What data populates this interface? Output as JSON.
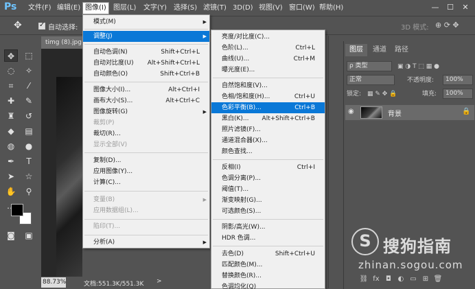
{
  "app": {
    "logo": "Ps"
  },
  "menubar": [
    {
      "label": "文件(F)"
    },
    {
      "label": "编辑(E)"
    },
    {
      "label": "图像(I)"
    },
    {
      "label": "图层(L)"
    },
    {
      "label": "文字(Y)"
    },
    {
      "label": "选择(S)"
    },
    {
      "label": "滤镜(T)"
    },
    {
      "label": "3D(D)"
    },
    {
      "label": "视图(V)"
    },
    {
      "label": "窗口(W)"
    },
    {
      "label": "帮助(H)"
    }
  ],
  "window_controls": {
    "minimize": "—",
    "maximize": "☐",
    "close": "✕"
  },
  "options": {
    "auto_select_label": "自动选择:",
    "mode_3d": "3D 模式:"
  },
  "document": {
    "tab": "timg (8).jpg",
    "zoom": "88.73%",
    "doc_size": "文档:551.3K/551.3K",
    "arrow": ">"
  },
  "image_menu": [
    {
      "label": "模式(M)",
      "submenu": true
    },
    {
      "label": "调整(J)",
      "submenu": true,
      "highlight": true
    },
    {
      "label": "自动色调(N)",
      "shortcut": "Shift+Ctrl+L"
    },
    {
      "label": "自动对比度(U)",
      "shortcut": "Alt+Shift+Ctrl+L"
    },
    {
      "label": "自动颜色(O)",
      "shortcut": "Shift+Ctrl+B"
    },
    {
      "label": "图像大小(I)...",
      "shortcut": "Alt+Ctrl+I"
    },
    {
      "label": "画布大小(S)...",
      "shortcut": "Alt+Ctrl+C"
    },
    {
      "label": "图像旋转(G)",
      "submenu": true
    },
    {
      "label": "裁剪(P)",
      "disabled": true
    },
    {
      "label": "裁切(R)..."
    },
    {
      "label": "显示全部(V)",
      "disabled": true
    },
    {
      "label": "复制(D)..."
    },
    {
      "label": "应用图像(Y)..."
    },
    {
      "label": "计算(C)..."
    },
    {
      "label": "变量(B)",
      "submenu": true,
      "disabled": true
    },
    {
      "label": "应用数据组(L)...",
      "disabled": true
    },
    {
      "label": "陷印(T)...",
      "disabled": true
    },
    {
      "label": "分析(A)",
      "submenu": true
    }
  ],
  "adjust_menu": [
    {
      "label": "亮度/对比度(C)..."
    },
    {
      "label": "色阶(L)...",
      "shortcut": "Ctrl+L"
    },
    {
      "label": "曲线(U)...",
      "shortcut": "Ctrl+M"
    },
    {
      "label": "曝光度(E)..."
    },
    {
      "label": "自然饱和度(V)..."
    },
    {
      "label": "色相/饱和度(H)...",
      "shortcut": "Ctrl+U"
    },
    {
      "label": "色彩平衡(B)...",
      "shortcut": "Ctrl+B",
      "highlight": true
    },
    {
      "label": "黑白(K)...",
      "shortcut": "Alt+Shift+Ctrl+B"
    },
    {
      "label": "照片滤镜(F)..."
    },
    {
      "label": "通道混合器(X)..."
    },
    {
      "label": "颜色查找..."
    },
    {
      "label": "反相(I)",
      "shortcut": "Ctrl+I"
    },
    {
      "label": "色调分离(P)..."
    },
    {
      "label": "阈值(T)..."
    },
    {
      "label": "渐变映射(G)..."
    },
    {
      "label": "可选颜色(S)..."
    },
    {
      "label": "阴影/高光(W)..."
    },
    {
      "label": "HDR 色调..."
    },
    {
      "label": "去色(D)",
      "shortcut": "Shift+Ctrl+U"
    },
    {
      "label": "匹配颜色(M)..."
    },
    {
      "label": "替换颜色(R)..."
    },
    {
      "label": "色调均化(Q)"
    }
  ],
  "layers_panel": {
    "tabs": [
      {
        "label": "图层"
      },
      {
        "label": "通道"
      },
      {
        "label": "路径"
      }
    ],
    "filter_kind": "ρ 类型",
    "blend_mode": "正常",
    "opacity_label": "不透明度:",
    "opacity_value": "100%",
    "lock_label": "锁定:",
    "fill_label": "填充:",
    "fill_value": "100%",
    "layer": {
      "name": "背景"
    }
  },
  "watermark": {
    "brand": "搜狗指南",
    "url": "zhinan.sogou.com",
    "logo_letter": "S"
  }
}
